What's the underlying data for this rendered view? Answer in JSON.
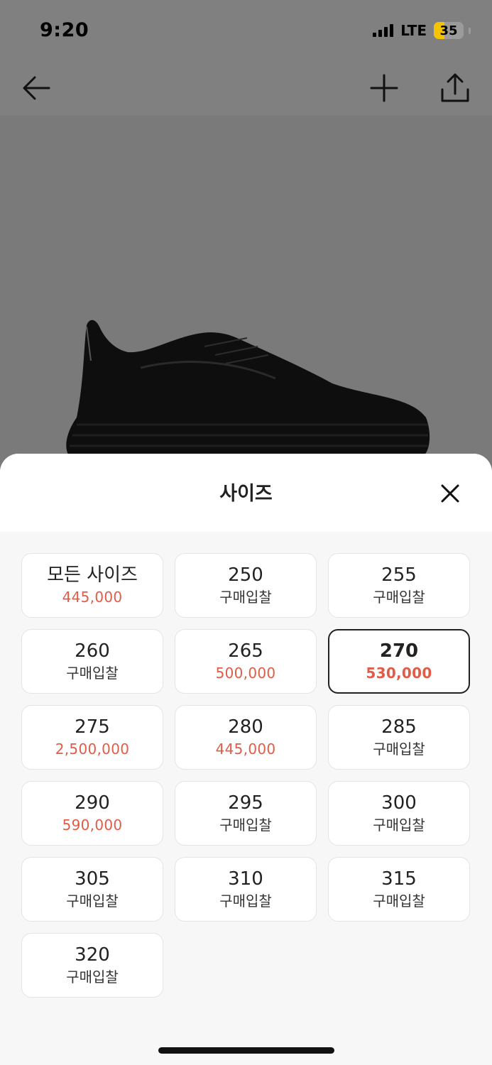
{
  "status_bar": {
    "time": "9:20",
    "network": "LTE",
    "battery": "35",
    "battery_level": 0.35,
    "battery_color": "#f5c400"
  },
  "nav": {
    "back_icon": "arrow-left-icon",
    "add_icon": "plus-icon",
    "share_icon": "share-icon"
  },
  "product": {
    "image": "black-running-shoe"
  },
  "sheet": {
    "title": "사이즈",
    "close_icon": "close-icon",
    "sizes": [
      {
        "label": "모든 사이즈",
        "sub": "445,000",
        "is_price": true,
        "selected": false
      },
      {
        "label": "250",
        "sub": "구매입찰",
        "is_price": false,
        "selected": false
      },
      {
        "label": "255",
        "sub": "구매입찰",
        "is_price": false,
        "selected": false
      },
      {
        "label": "260",
        "sub": "구매입찰",
        "is_price": false,
        "selected": false
      },
      {
        "label": "265",
        "sub": "500,000",
        "is_price": true,
        "selected": false
      },
      {
        "label": "270",
        "sub": "530,000",
        "is_price": true,
        "selected": true
      },
      {
        "label": "275",
        "sub": "2,500,000",
        "is_price": true,
        "selected": false
      },
      {
        "label": "280",
        "sub": "445,000",
        "is_price": true,
        "selected": false
      },
      {
        "label": "285",
        "sub": "구매입찰",
        "is_price": false,
        "selected": false
      },
      {
        "label": "290",
        "sub": "590,000",
        "is_price": true,
        "selected": false
      },
      {
        "label": "295",
        "sub": "구매입찰",
        "is_price": false,
        "selected": false
      },
      {
        "label": "300",
        "sub": "구매입찰",
        "is_price": false,
        "selected": false
      },
      {
        "label": "305",
        "sub": "구매입찰",
        "is_price": false,
        "selected": false
      },
      {
        "label": "310",
        "sub": "구매입찰",
        "is_price": false,
        "selected": false
      },
      {
        "label": "315",
        "sub": "구매입찰",
        "is_price": false,
        "selected": false
      },
      {
        "label": "320",
        "sub": "구매입찰",
        "is_price": false,
        "selected": false
      }
    ]
  },
  "colors": {
    "price": "#e15c47",
    "text": "#222222",
    "selected_border": "#222222",
    "overlay": "#7a7a7a"
  }
}
